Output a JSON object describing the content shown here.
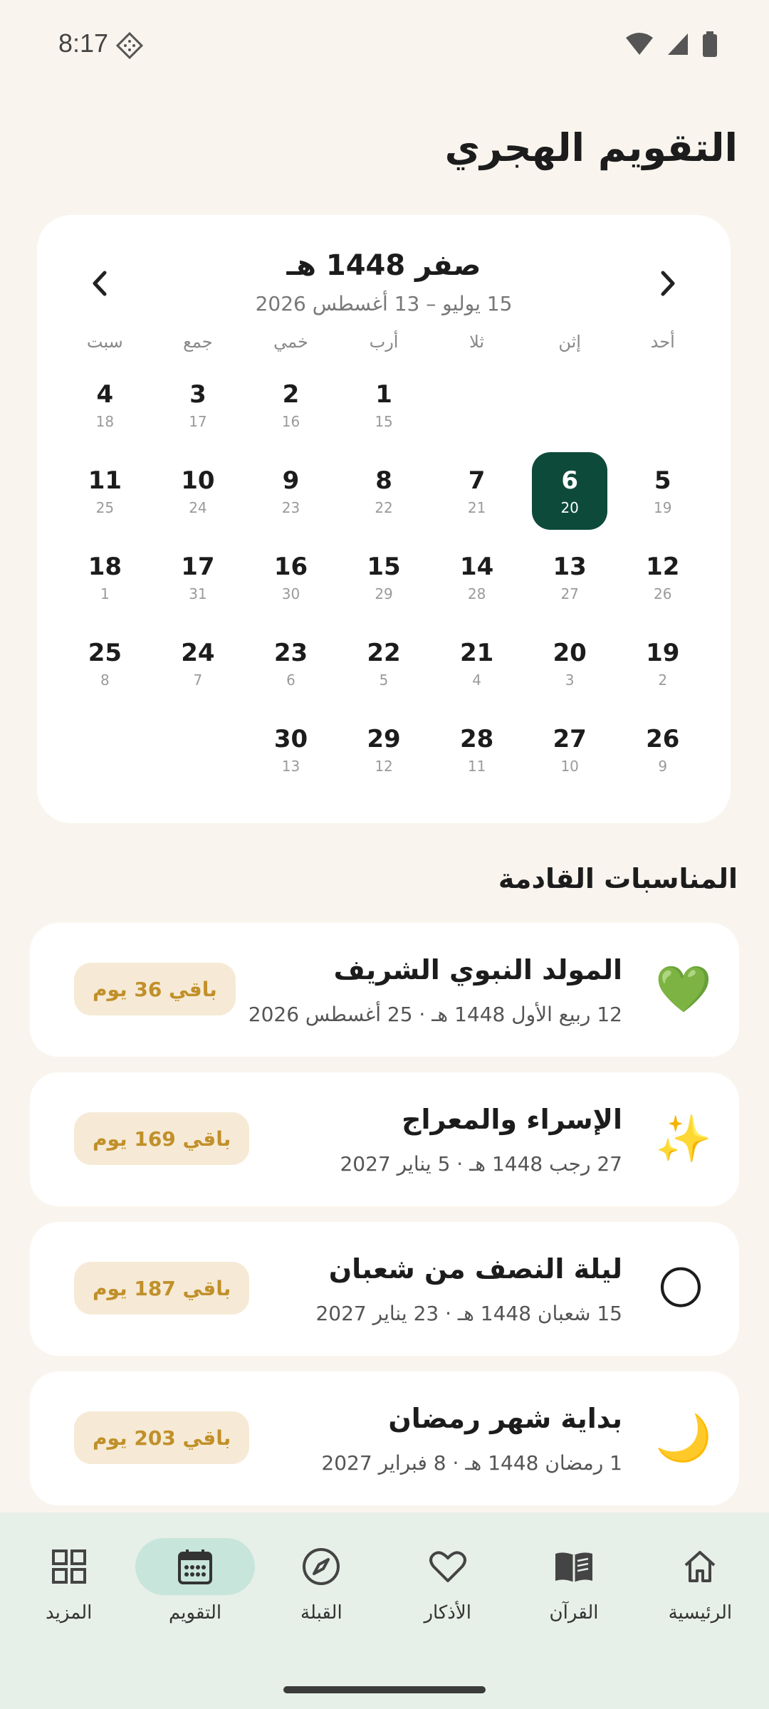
{
  "status_bar": {
    "time": "8:17"
  },
  "page_title": "التقويم الهجري",
  "calendar": {
    "month_label": "صفر 1448 هـ",
    "gregorian_range": "15 يوليو – 13 أغسطس 2026",
    "weekdays": [
      "أحد",
      "إثن",
      "ثلا",
      "أرب",
      "خمي",
      "جمع",
      "سبت"
    ],
    "leading_blanks": 3,
    "days": [
      {
        "h": "1",
        "g": "15"
      },
      {
        "h": "2",
        "g": "16"
      },
      {
        "h": "3",
        "g": "17"
      },
      {
        "h": "4",
        "g": "18"
      },
      {
        "h": "5",
        "g": "19"
      },
      {
        "h": "6",
        "g": "20",
        "today": true
      },
      {
        "h": "7",
        "g": "21"
      },
      {
        "h": "8",
        "g": "22"
      },
      {
        "h": "9",
        "g": "23"
      },
      {
        "h": "10",
        "g": "24"
      },
      {
        "h": "11",
        "g": "25"
      },
      {
        "h": "12",
        "g": "26"
      },
      {
        "h": "13",
        "g": "27"
      },
      {
        "h": "14",
        "g": "28"
      },
      {
        "h": "15",
        "g": "29"
      },
      {
        "h": "16",
        "g": "30"
      },
      {
        "h": "17",
        "g": "31"
      },
      {
        "h": "18",
        "g": "1"
      },
      {
        "h": "19",
        "g": "2"
      },
      {
        "h": "20",
        "g": "3"
      },
      {
        "h": "21",
        "g": "4"
      },
      {
        "h": "22",
        "g": "5"
      },
      {
        "h": "23",
        "g": "6"
      },
      {
        "h": "24",
        "g": "7"
      },
      {
        "h": "25",
        "g": "8"
      },
      {
        "h": "26",
        "g": "9"
      },
      {
        "h": "27",
        "g": "10"
      },
      {
        "h": "28",
        "g": "11"
      },
      {
        "h": "29",
        "g": "12"
      },
      {
        "h": "30",
        "g": "13"
      }
    ]
  },
  "upcoming": {
    "title": "المناسبات القادمة",
    "events": [
      {
        "icon": "green-heart-icon",
        "emoji": "💚",
        "title": "المولد النبوي الشريف",
        "date": "12 ربيع الأول 1448 هـ · 25 أغسطس 2026",
        "badge": "باقي 36 يوم"
      },
      {
        "icon": "sparkles-icon",
        "emoji": "✨",
        "title": "الإسراء والمعراج",
        "date": "27 رجب 1448 هـ · 5 يناير 2027",
        "badge": "باقي 169 يوم"
      },
      {
        "icon": "full-moon-icon",
        "emoji": "🌕",
        "title": "ليلة النصف من شعبان",
        "date": "15 شعبان 1448 هـ · 23 يناير 2027",
        "badge": "باقي 187 يوم"
      },
      {
        "icon": "crescent-moon-icon",
        "emoji": "🌙",
        "title": "بداية شهر رمضان",
        "date": "1 رمضان 1448 هـ · 8 فبراير 2027",
        "badge": "باقي 203 يوم"
      }
    ]
  },
  "bottom_nav": {
    "items": [
      {
        "label": "الرئيسية",
        "icon": "home-icon"
      },
      {
        "label": "القرآن",
        "icon": "book-icon"
      },
      {
        "label": "الأذكار",
        "icon": "heart-icon"
      },
      {
        "label": "القبلة",
        "icon": "compass-icon"
      },
      {
        "label": "التقويم",
        "icon": "calendar-icon",
        "active": true
      },
      {
        "label": "المزيد",
        "icon": "grid-icon"
      }
    ]
  },
  "colors": {
    "accent": "#0d4a3a",
    "background": "#f9f5ee",
    "badge_text": "#c1902a",
    "badge_bg": "#f6ead6",
    "nav_bg": "#e7efe9"
  }
}
